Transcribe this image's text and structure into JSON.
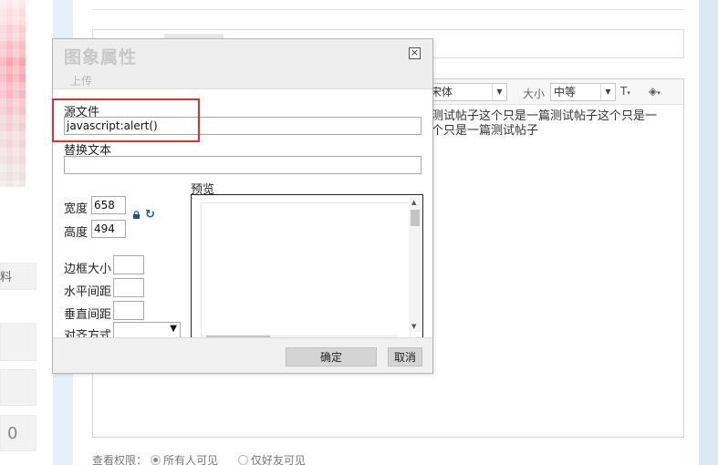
{
  "page": {
    "side_label": "料",
    "side_count": "0",
    "editor": {
      "font_name": "宋体",
      "size_label": "大小",
      "size_value": "中等",
      "line1": "测试帖子这个只是一篇测试帖子这个只是一",
      "line2": "个只是一篇测试帖子"
    },
    "permission": {
      "label": "查看权限：",
      "option_all": "所有人可见",
      "option_friends": "仅好友可见",
      "selected": "option_all"
    }
  },
  "dialog": {
    "title": "图象属性",
    "tab_upload": "上传",
    "source_label": "源文件",
    "source_value": "javascript:alert()",
    "alt_label": "替换文本",
    "alt_value": "",
    "width_label": "宽度",
    "width_value": "658",
    "height_label": "高度",
    "height_value": "494",
    "border_label": "边框大小",
    "hspace_label": "水平间距",
    "vspace_label": "垂直间距",
    "align_label": "对齐方式",
    "align_value": "",
    "preview_label": "预览",
    "ok_label": "确定",
    "cancel_label": "取消"
  },
  "colors": {
    "highlight": "#e03030",
    "refresh_icon": "#1e5aa8"
  }
}
